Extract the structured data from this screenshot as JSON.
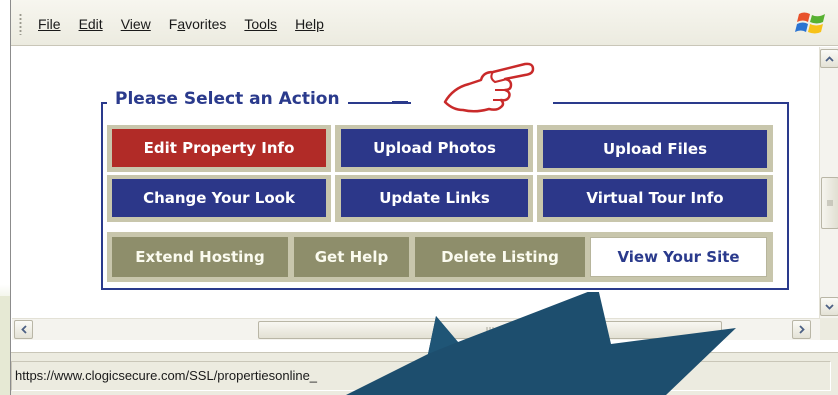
{
  "menu": {
    "items": [
      {
        "label": "File",
        "accel_index": 0
      },
      {
        "label": "Edit",
        "accel_index": 0
      },
      {
        "label": "View",
        "accel_index": 0
      },
      {
        "label": "Favorites",
        "accel_index": 1
      },
      {
        "label": "Tools",
        "accel_index": 0
      },
      {
        "label": "Help",
        "accel_index": 0
      }
    ]
  },
  "panel": {
    "title": "Please Select an Action"
  },
  "actions": {
    "row1": [
      "Edit Property Info",
      "Upload Photos",
      "Upload Files"
    ],
    "row2": [
      "Change Your Look",
      "Update Links",
      "Virtual Tour Info"
    ],
    "row3": [
      "Extend Hosting",
      "Get Help",
      "Delete Listing",
      "View Your Site"
    ]
  },
  "status": {
    "url": "https://www.clogicsecure.com/SSL/propertiesonline_"
  },
  "colors": {
    "navy": "#2c3789",
    "red": "#b12b27",
    "olive": "#8e8e6b",
    "frame": "#c8c6ac",
    "starburst": "#1d4e6e"
  },
  "icons": {
    "hand": "pointing-hand-icon",
    "windows": "windows-logo-icon"
  }
}
